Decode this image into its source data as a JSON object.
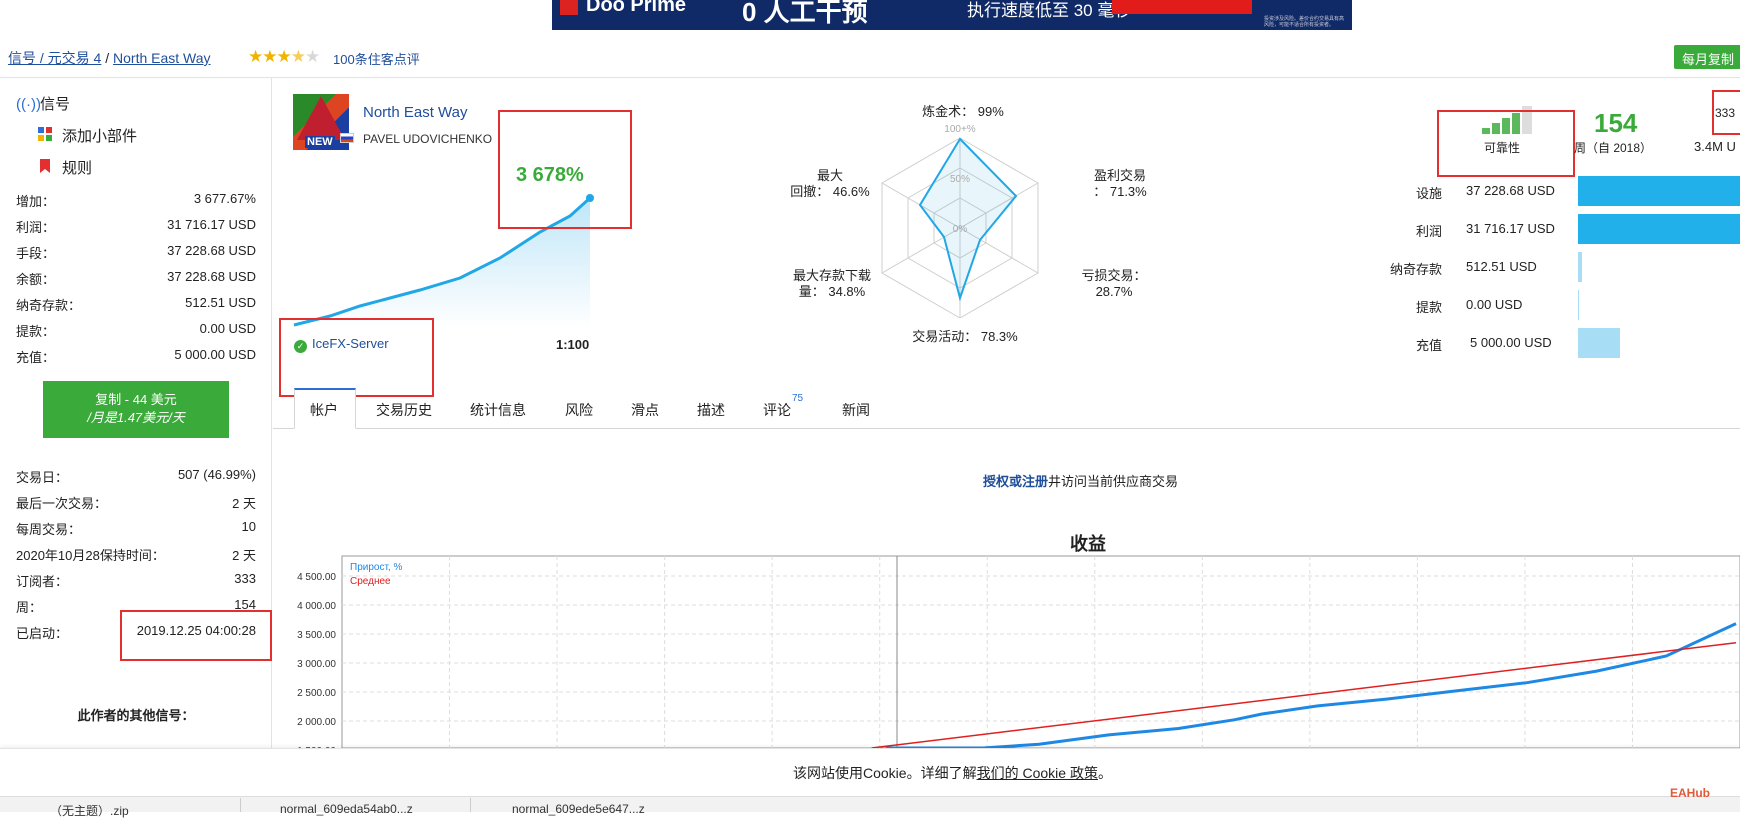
{
  "ad": {
    "brand": "Doo Prime",
    "headline": "0 人工干预",
    "speed": "执行速度低至 30 毫秒",
    "fine": "投资涉及风险。差价合约交易具有高风险，可能不适合所有投资者。"
  },
  "breadcrumb": {
    "part1": "信号 / 元交易 4",
    "sep": " / ",
    "part2": "North East Way"
  },
  "rating": {
    "stars": "★★★★★",
    "reviews": "100条住客点评"
  },
  "monthly_button": "每月复制",
  "sidebar": {
    "nav": [
      {
        "label": "信号",
        "icon": "signal-icon"
      },
      {
        "label": "添加小部件",
        "icon": "widget-icon"
      },
      {
        "label": "规则",
        "icon": "bookmark-icon"
      }
    ],
    "stats": [
      {
        "label": "增加：",
        "value": "3 677.67%"
      },
      {
        "label": "利润：",
        "value": "31 716.17 USD"
      },
      {
        "label": "手段：",
        "value": "37 228.68 USD"
      },
      {
        "label": "余额：",
        "value": "37 228.68 USD"
      },
      {
        "label": "纳奇存款：",
        "value": "512.51 USD"
      },
      {
        "label": "提款：",
        "value": "0.00 USD"
      },
      {
        "label": "充值：",
        "value": "5 000.00 USD"
      }
    ],
    "copy_button": {
      "line1": "复制 - 44 美元",
      "line2": "/月是1.47美元/天"
    },
    "stats2": [
      {
        "label": "交易日：",
        "value": "507 (46.99%)"
      },
      {
        "label": "最后一次交易：",
        "value": "2 天"
      },
      {
        "label": "每周交易：",
        "value": "10"
      },
      {
        "label": "2020年10月28保持时间：",
        "value": "2 天"
      },
      {
        "label": "订阅者：",
        "value": "333"
      },
      {
        "label": "周：",
        "value": "154"
      },
      {
        "label": "已启动：",
        "value": "2019.12.25 04:00:28"
      }
    ],
    "other_signals": "此作者的其他信号："
  },
  "signal": {
    "name": "North East Way",
    "author": "PAVEL UDOVICHENKO",
    "logo_badge": "NEW",
    "growth": "3 678%",
    "server": "IceFX-Server",
    "leverage": "1:100"
  },
  "radar": {
    "alchemy": "炼金术： 99%",
    "ring100": "100+%",
    "ring50": "50%",
    "ring0": "0%",
    "profit_trades": "盈利交易\n： 71.3%",
    "loss_trades": "亏损交易：\n28.7%",
    "activity": "交易活动： 78.3%",
    "max_deposit_load": "最大存款下载\n量： 34.8%",
    "max_drawdown": "最大\n回撤： 46.6%"
  },
  "right": {
    "reliability_label": "可靠性",
    "weeks": "154",
    "weeks_sub": "周（自 2018）",
    "subscribers": "333",
    "subscribers_money": "3.4M U",
    "fin": [
      {
        "label": "设施",
        "value": "37 228.68 USD",
        "bar": 1.0
      },
      {
        "label": "利润",
        "value": "31 716.17 USD",
        "bar": 0.852
      },
      {
        "label": "纳奇存款",
        "value": "512.51 USD",
        "bar": 0.014
      },
      {
        "label": "提款",
        "value": "0.00 USD",
        "bar": 0.0
      },
      {
        "label": "充值",
        "value": "5 000.00 USD",
        "bar": 0.134
      }
    ]
  },
  "tabs": [
    {
      "label": "帐户"
    },
    {
      "label": "交易历史"
    },
    {
      "label": "统计信息"
    },
    {
      "label": "风险"
    },
    {
      "label": "滑点"
    },
    {
      "label": "描述"
    },
    {
      "label": "评论"
    },
    {
      "label": "新闻"
    }
  ],
  "review_count": "75",
  "auth": {
    "link": "授权或注册",
    "rest": "井访问当前供应商交易"
  },
  "chart_data": {
    "type": "line",
    "title": "收益",
    "legend": [
      "Прирост, %",
      "Среднее"
    ],
    "yticks": [
      "4 500.00",
      "4 000.00",
      "3 500.00",
      "3 000.00",
      "2 500.00",
      "2 000.00",
      "1 500.00"
    ],
    "ylim": [
      1300,
      4600
    ],
    "series": [
      {
        "name": "Прирост, %",
        "color": "#1e88e5",
        "x": [
          0.39,
          0.42,
          0.46,
          0.5,
          0.55,
          0.6,
          0.64,
          0.66,
          0.7,
          0.75,
          0.8,
          0.85,
          0.9,
          0.95,
          1.0
        ],
        "y": [
          1300,
          1380,
          1480,
          1600,
          1760,
          1870,
          2020,
          2120,
          2260,
          2380,
          2520,
          2660,
          2860,
          3120,
          3680
        ]
      },
      {
        "name": "Среднее",
        "color": "#e02020",
        "x": [
          0.38,
          1.0
        ],
        "y": [
          1300,
          3350
        ]
      }
    ]
  },
  "cookie": {
    "pre": "该网站使用Cookie。详细了解",
    "link": "我们的 Cookie 政策",
    "post": "。"
  },
  "downloads": [
    "（无主题）.zip",
    "normal_609eda54ab0...z",
    "normal_609ede5e647...z"
  ],
  "watermark": "EAHub"
}
